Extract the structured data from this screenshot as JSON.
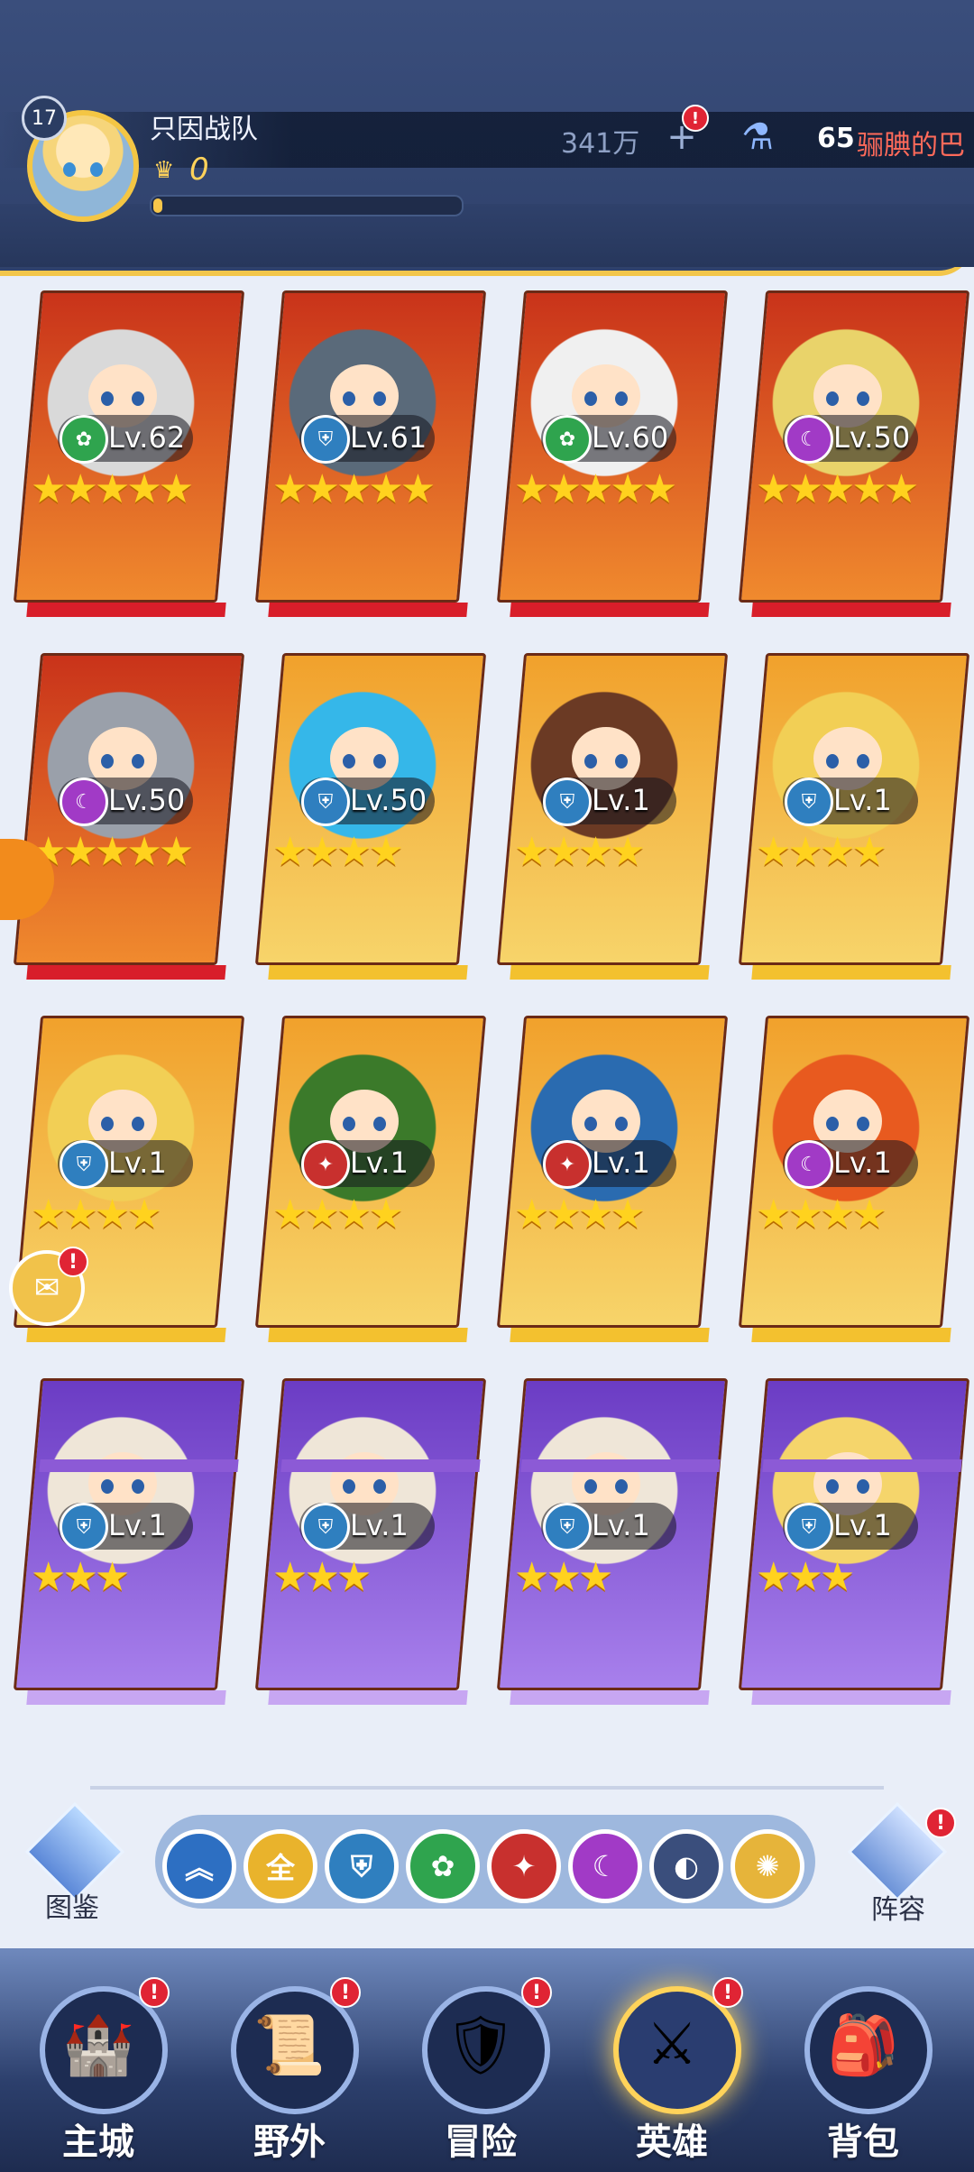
{
  "header": {
    "player_level": "17",
    "team_name": "只因战队",
    "power": "0",
    "exp_fraction": 0.03,
    "gold": "341万",
    "potion_count": "65",
    "scroll_text": "骊腆的巴"
  },
  "heroes": [
    {
      "level": "Lv.62",
      "stars": "★★★★★",
      "class": "nature",
      "rarity": "red"
    },
    {
      "level": "Lv.61",
      "stars": "★★★★★",
      "class": "guard",
      "rarity": "red"
    },
    {
      "level": "Lv.60",
      "stars": "★★★★★",
      "class": "nature",
      "rarity": "red"
    },
    {
      "level": "Lv.50",
      "stars": "★★★★★",
      "class": "dark",
      "rarity": "red"
    },
    {
      "level": "Lv.50",
      "stars": "★★★★★",
      "class": "dark",
      "rarity": "red"
    },
    {
      "level": "Lv.50",
      "stars": "★★★★",
      "class": "guard",
      "rarity": "gold"
    },
    {
      "level": "Lv.1",
      "stars": "★★★★",
      "class": "guard",
      "rarity": "gold"
    },
    {
      "level": "Lv.1",
      "stars": "★★★★",
      "class": "guard",
      "rarity": "gold"
    },
    {
      "level": "Lv.1",
      "stars": "★★★★",
      "class": "guard",
      "rarity": "gold"
    },
    {
      "level": "Lv.1",
      "stars": "★★★★",
      "class": "fire",
      "rarity": "gold"
    },
    {
      "level": "Lv.1",
      "stars": "★★★★",
      "class": "fire",
      "rarity": "gold"
    },
    {
      "level": "Lv.1",
      "stars": "★★★★",
      "class": "dark",
      "rarity": "gold"
    },
    {
      "level": "Lv.1",
      "stars": "★★★",
      "class": "guard",
      "rarity": "purple"
    },
    {
      "level": "Lv.1",
      "stars": "★★★",
      "class": "guard",
      "rarity": "purple"
    },
    {
      "level": "Lv.1",
      "stars": "★★★",
      "class": "guard",
      "rarity": "purple"
    },
    {
      "level": "Lv.1",
      "stars": "★★★",
      "class": "guard",
      "rarity": "purple"
    }
  ],
  "side": {
    "codex_label": "图鉴",
    "formation_label": "阵容",
    "formation_badge": "!"
  },
  "filters": [
    {
      "name": "collapse",
      "label": "︽"
    },
    {
      "name": "all",
      "label": "全"
    },
    {
      "name": "guard",
      "label": ""
    },
    {
      "name": "nature",
      "label": ""
    },
    {
      "name": "fire",
      "label": ""
    },
    {
      "name": "dark",
      "label": ""
    },
    {
      "name": "moon",
      "label": ""
    },
    {
      "name": "light",
      "label": ""
    }
  ],
  "nav": {
    "items": [
      {
        "label": "主城",
        "badge": "!"
      },
      {
        "label": "野外",
        "badge": "!"
      },
      {
        "label": "冒险",
        "badge": "!"
      },
      {
        "label": "英雄",
        "badge": "!"
      },
      {
        "label": "背包",
        "badge": ""
      }
    ]
  },
  "colors": {
    "accent_gold": "#f4c644",
    "rarity_red": "#d9441f",
    "rarity_gold": "#f2a92e",
    "rarity_purple": "#8e5ad9"
  }
}
